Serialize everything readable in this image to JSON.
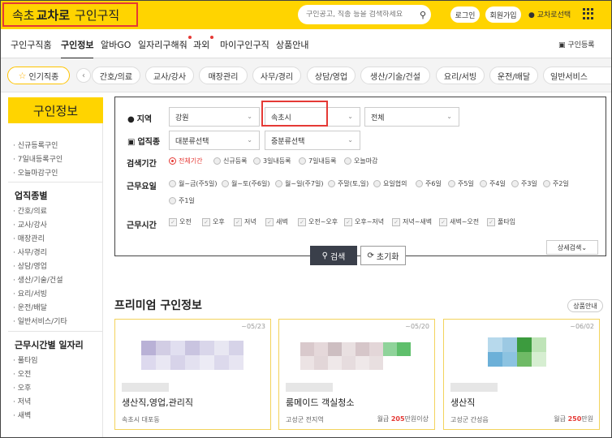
{
  "header": {
    "logo_region": "속초",
    "logo_brand": "교차로",
    "logo_suffix": "구인구직",
    "search_placeholder": "구인공고, 직종 등을 검색하세요",
    "login": "로그인",
    "signup": "회원가입",
    "region_select": "교차로선택"
  },
  "nav": {
    "items": [
      {
        "label": "구인구직홈"
      },
      {
        "label": "구인정보"
      },
      {
        "label": "알바GO"
      },
      {
        "label": "일자리구해줘"
      },
      {
        "label": "과외"
      },
      {
        "label": "마이구인구직"
      },
      {
        "label": "상품안내"
      }
    ],
    "register": "구인등록"
  },
  "categories": {
    "popular": "인기직종",
    "items": [
      "간호/의료",
      "교사/강사",
      "매장관리",
      "사무/경리",
      "상담/영업",
      "생산/기술/건설",
      "요리/서빙",
      "운전/배달",
      "일반서비스"
    ]
  },
  "sidebar": {
    "title": "구인정보",
    "group1": [
      "신규등록구인",
      "7일내등록구인",
      "오늘마감구인"
    ],
    "section2": "업직종별",
    "group2": [
      "간호/의료",
      "교사/강사",
      "매장관리",
      "사무/경리",
      "상담/영업",
      "생산/기술/건설",
      "요리/서빙",
      "운전/배달",
      "일반서비스/기타"
    ],
    "section3": "근무시간별 일자리",
    "group3": [
      "풀타임",
      "오전",
      "오후",
      "저녁",
      "새벽"
    ]
  },
  "search_panel": {
    "region_label": "지역",
    "region1": "강원",
    "region2": "속초시",
    "region3": "전체",
    "job_label": "업직종",
    "job1": "대분류선택",
    "job2": "중분류선택",
    "period_label": "검색기간",
    "periods": [
      "전체기간",
      "신규등록",
      "3일내등록",
      "7일내등록",
      "오늘마감"
    ],
    "weekday_label": "근무요일",
    "weekdays": [
      "월~금(주5일)",
      "월~토(주6일)",
      "월~일(주7일)",
      "주말(토,일)",
      "요일협의",
      "주6일",
      "주5일",
      "주4일",
      "주3일",
      "주2일",
      "주1일"
    ],
    "time_label": "근무시간",
    "times": [
      "오전",
      "오후",
      "저녁",
      "새벽",
      "오전~오후",
      "오후~저녁",
      "저녁~새벽",
      "새벽~오전",
      "풀타임"
    ],
    "detail": "상세검색",
    "search": "검색",
    "reset": "초기화"
  },
  "premium": {
    "title": "프리미엄 구인정보",
    "more": "상품안내",
    "cards": [
      {
        "date": "~05/23",
        "title": "생산직,영업,관리직",
        "location": "속초시 대포동",
        "pay_prefix": "",
        "pay_amount": "",
        "pay_suffix": ""
      },
      {
        "date": "~05/20",
        "title": "룸메이드 객실청소",
        "location": "고성군 전지역",
        "pay_prefix": "월급",
        "pay_amount": "205",
        "pay_suffix": "만원이상"
      },
      {
        "date": "~06/02",
        "title": "생산직",
        "location": "고성군 간성읍",
        "pay_prefix": "월급",
        "pay_amount": "250",
        "pay_suffix": "만원"
      }
    ]
  },
  "colors": {
    "brand": "#ffd400",
    "highlight": "#e53935",
    "dark_button": "#3a3f4a"
  }
}
